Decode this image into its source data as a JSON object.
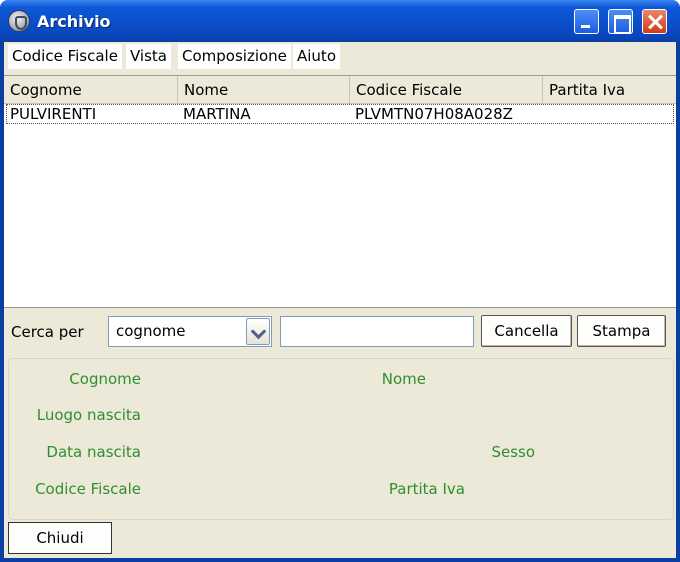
{
  "window": {
    "title": "Archivio",
    "icon": "seal-emblem-icon"
  },
  "menu": {
    "items": [
      "Codice Fiscale",
      "Vista",
      "Composizione",
      "Aiuto"
    ]
  },
  "table": {
    "columns": [
      "Cognome",
      "Nome",
      "Codice Fiscale",
      "Partita Iva"
    ],
    "rows": [
      [
        "PULVIRENTI",
        "MARTINA",
        "PLVMTN07H08A028Z",
        ""
      ]
    ]
  },
  "search": {
    "label": "Cerca per",
    "field_selected": "cognome",
    "query": "",
    "clear_label": "Cancella",
    "print_label": "Stampa"
  },
  "details": {
    "cognome": "Cognome",
    "nome": "Nome",
    "luogo_nascita": "Luogo nascita",
    "data_nascita": "Data nascita",
    "sesso": "Sesso",
    "codice_fiscale": "Codice Fiscale",
    "partita_iva": "Partita Iva"
  },
  "footer": {
    "close_label": "Chiudi"
  },
  "colors": {
    "titlebar": "#0a4ec8",
    "detail_label": "#2f8f2f",
    "close_button": "#d23a18"
  }
}
